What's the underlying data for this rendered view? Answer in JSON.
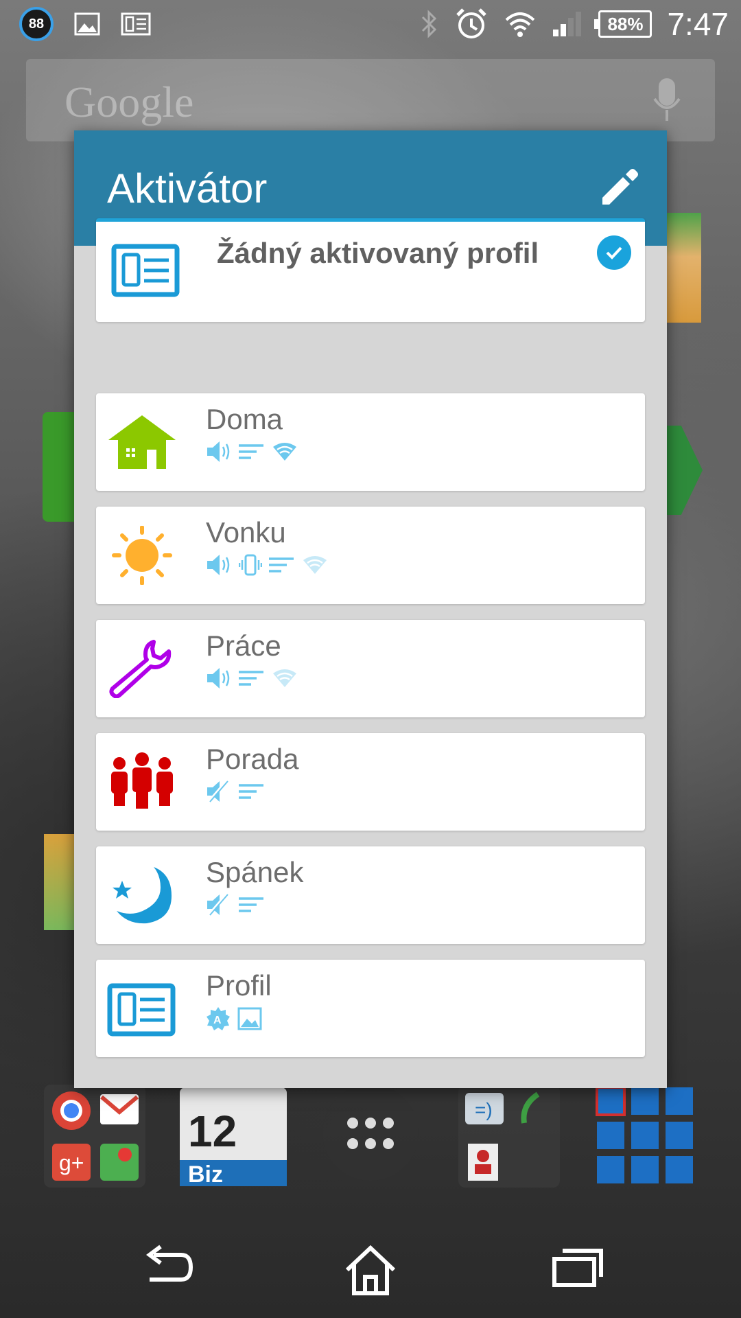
{
  "statusbar": {
    "notification_count": "88",
    "battery": "88%",
    "time": "7:47"
  },
  "homescreen": {
    "search_logo": "Google"
  },
  "dialog": {
    "title": "Aktivátor",
    "active_profile": {
      "name": "Žádný aktivovaný profil",
      "icon": "profile-card-icon"
    },
    "profiles": [
      {
        "name": "Doma",
        "icon": "house-icon",
        "color": "#8cc800",
        "indicators": [
          "volume-icon",
          "notification-lines-icon",
          "wifi-icon"
        ]
      },
      {
        "name": "Vonku",
        "icon": "sun-icon",
        "color": "#ffb02e",
        "indicators": [
          "volume-icon",
          "vibrate-icon",
          "notification-lines-icon",
          "wifi-off-icon"
        ]
      },
      {
        "name": "Práce",
        "icon": "wrench-icon",
        "color": "#b000e8",
        "indicators": [
          "volume-icon",
          "notification-lines-icon",
          "wifi-off-icon"
        ]
      },
      {
        "name": "Porada",
        "icon": "people-icon",
        "color": "#d40000",
        "indicators": [
          "mute-icon",
          "notification-lines-icon"
        ]
      },
      {
        "name": "Spánek",
        "icon": "moon-icon",
        "color": "#1a9ad6",
        "indicators": [
          "mute-icon",
          "notification-lines-icon"
        ]
      },
      {
        "name": "Profil",
        "icon": "profile-card-icon",
        "color": "#1a9ad6",
        "indicators": [
          "auto-brightness-icon",
          "wallpaper-icon"
        ]
      }
    ]
  },
  "colors": {
    "header": "#2a7fa5",
    "accent": "#1fa3d8",
    "indicator": "#6cc8ee"
  }
}
